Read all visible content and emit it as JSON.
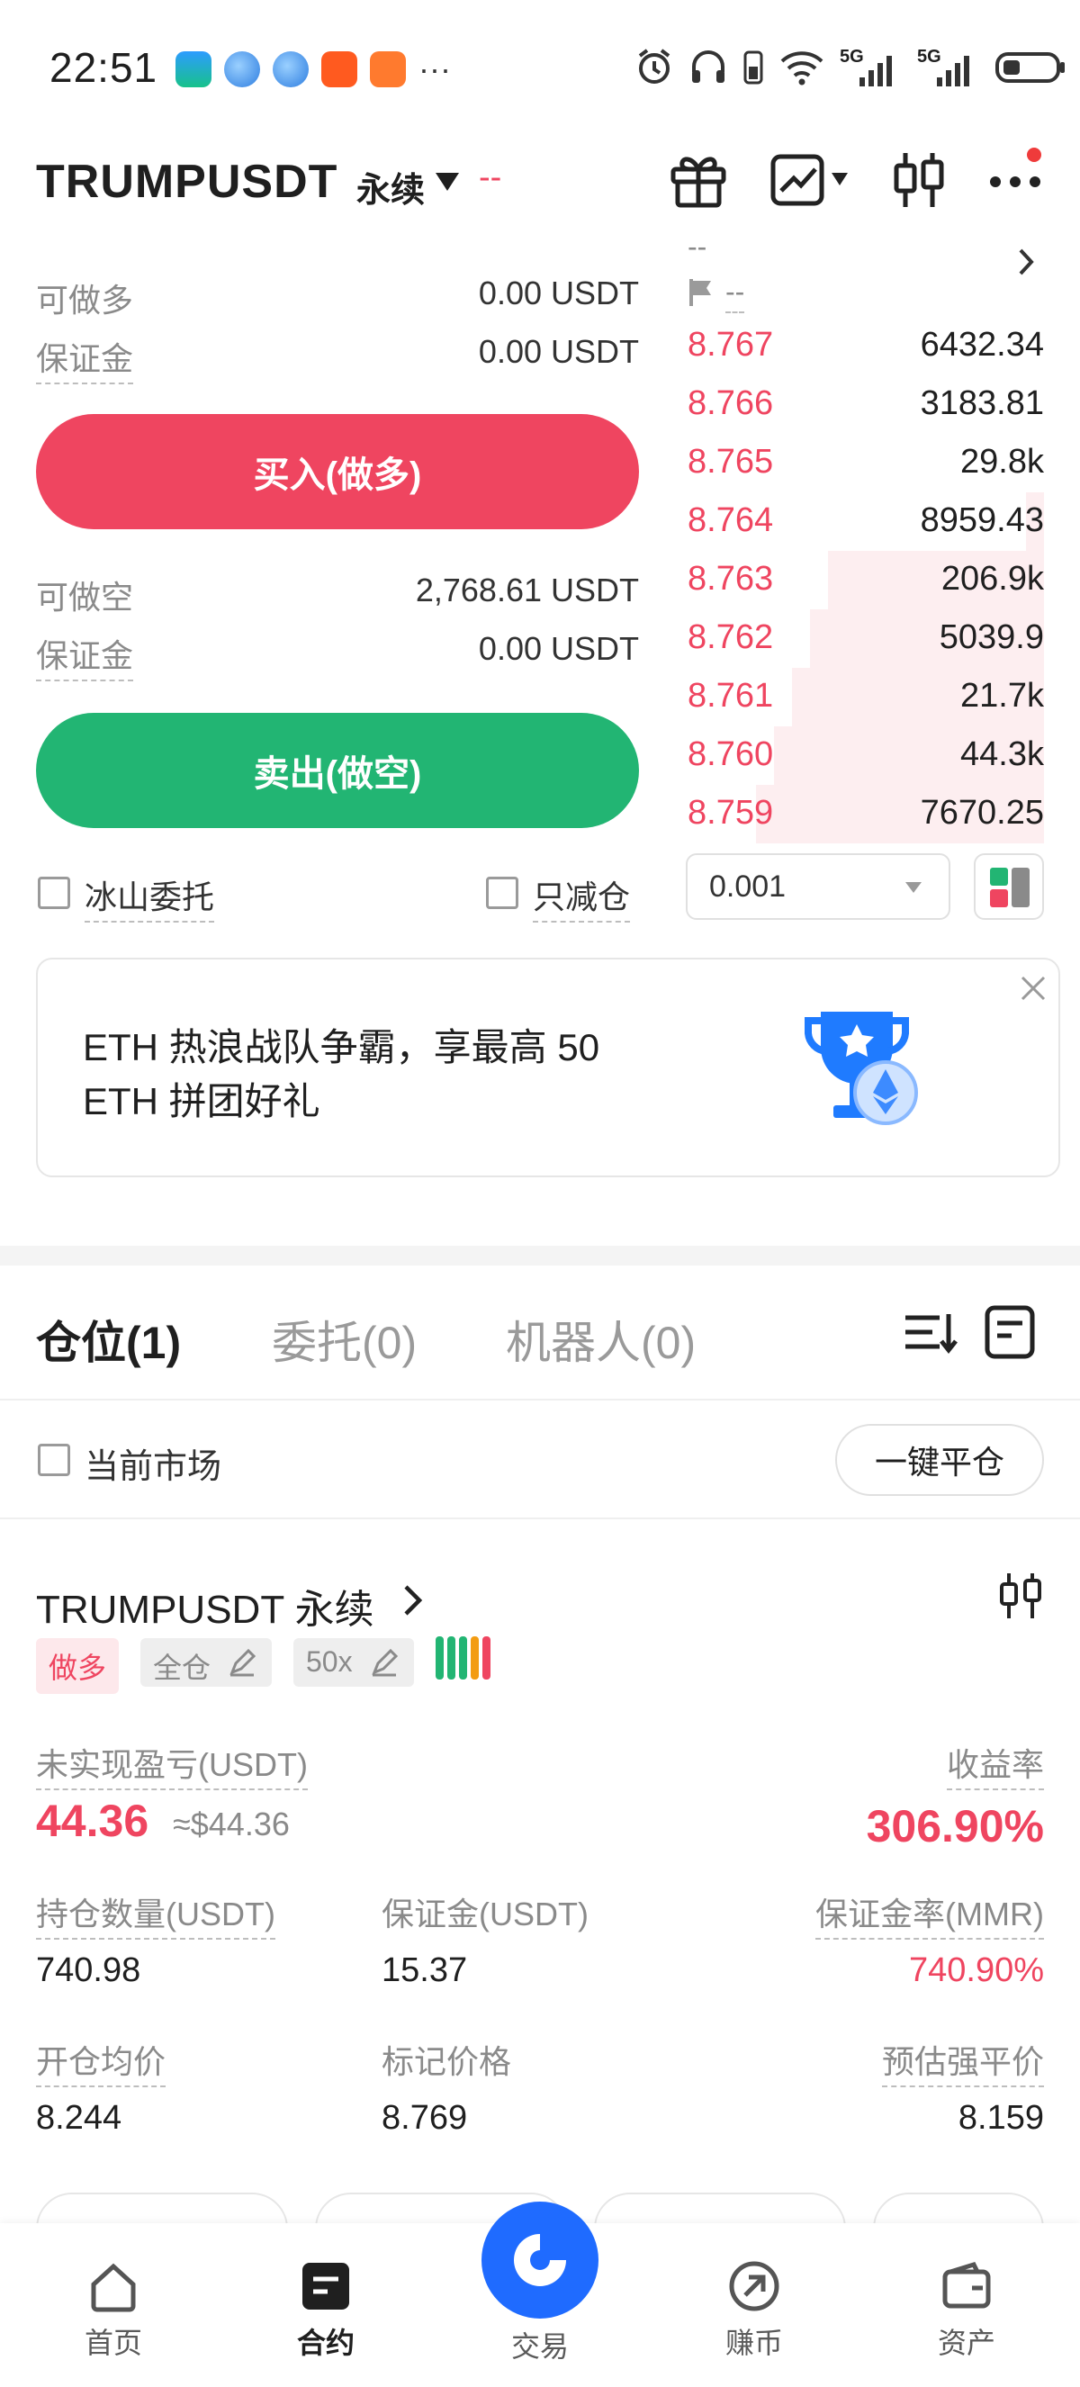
{
  "status_bar": {
    "time": "22:51",
    "more": "···",
    "network_1": "5G",
    "network_2": "5G"
  },
  "header": {
    "symbol": "TRUMPUSDT",
    "contract_type": "永续",
    "change": "--"
  },
  "order_form": {
    "long_available_label": "可做多",
    "long_available_value": "0.00 USDT",
    "long_margin_label": "保证金",
    "long_margin_value": "0.00 USDT",
    "buy_button": "买入(做多)",
    "short_available_label": "可做空",
    "short_available_value": "2,768.61 USDT",
    "short_margin_label": "保证金",
    "short_margin_value": "0.00 USDT",
    "sell_button": "卖出(做空)",
    "iceberg_label": "冰山委托",
    "reduce_only_label": "只减仓"
  },
  "orderbook": {
    "header_dash": "--",
    "flag_dash": "--",
    "rows": [
      {
        "price": "8.767",
        "amount": "6432.34",
        "depth": 0.0
      },
      {
        "price": "8.766",
        "amount": "3183.81",
        "depth": 0.0
      },
      {
        "price": "8.765",
        "amount": "29.8k",
        "depth": 0.0
      },
      {
        "price": "8.764",
        "amount": "8959.43",
        "depth": 0.05
      },
      {
        "price": "8.763",
        "amount": "206.9k",
        "depth": 0.6
      },
      {
        "price": "8.762",
        "amount": "5039.9",
        "depth": 0.65
      },
      {
        "price": "8.761",
        "amount": "21.7k",
        "depth": 0.7
      },
      {
        "price": "8.760",
        "amount": "44.3k",
        "depth": 0.75
      },
      {
        "price": "8.759",
        "amount": "7670.25",
        "depth": 0.8
      }
    ],
    "precision": "0.001"
  },
  "banner": {
    "line1": "ETH 热浪战队争霸，享最高 50",
    "line2": "ETH 拼团好礼"
  },
  "tabs": {
    "positions": "仓位(1)",
    "orders": "委托(0)",
    "bots": "机器人(0)"
  },
  "filter": {
    "current_market": "当前市场",
    "close_all": "一键平仓"
  },
  "position": {
    "symbol": "TRUMPUSDT 永续",
    "side": "做多",
    "margin_mode": "全仓",
    "leverage": "50x",
    "upnl_label": "未实现盈亏(USDT)",
    "upnl_value": "44.36",
    "upnl_usd": "≈$44.36",
    "roe_label": "收益率",
    "roe_value": "306.90%",
    "size_label": "持仓数量(USDT)",
    "size_value": "740.98",
    "margin_label": "保证金(USDT)",
    "margin_value": "15.37",
    "mmr_label": "保证金率(MMR)",
    "mmr_value": "740.90%",
    "entry_label": "开仓均价",
    "entry_value": "8.244",
    "mark_label": "标记价格",
    "mark_value": "8.769",
    "liq_label": "预估强平价",
    "liq_value": "8.159"
  },
  "bottom_nav": {
    "home": "首页",
    "futures": "合约",
    "trade": "交易",
    "earn": "赚币",
    "assets": "资产"
  },
  "colors": {
    "buy": "#ef4560",
    "sell": "#22b573",
    "nav_active_circle": "#1f6bff"
  }
}
